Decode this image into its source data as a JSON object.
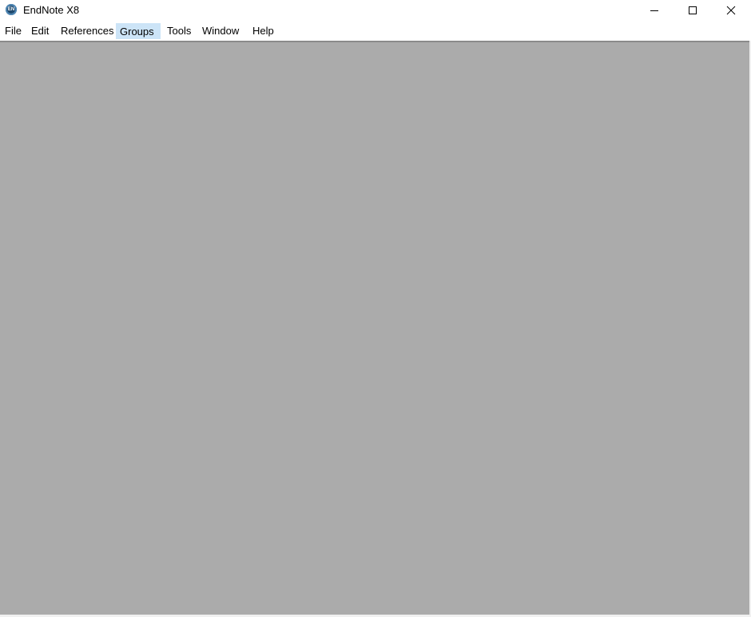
{
  "window": {
    "title": "EndNote X8",
    "app_icon_label": "EN",
    "controls": {
      "minimize": "minimize-icon",
      "maximize": "maximize-icon",
      "close": "close-icon"
    }
  },
  "menubar": {
    "items": [
      {
        "label": "File"
      },
      {
        "label": "Edit"
      },
      {
        "label": "References"
      },
      {
        "label": "Groups",
        "active": true
      },
      {
        "label": "Tools"
      },
      {
        "label": "Window"
      },
      {
        "label": "Help"
      }
    ]
  },
  "workspace": {
    "background_color": "#ababab"
  }
}
